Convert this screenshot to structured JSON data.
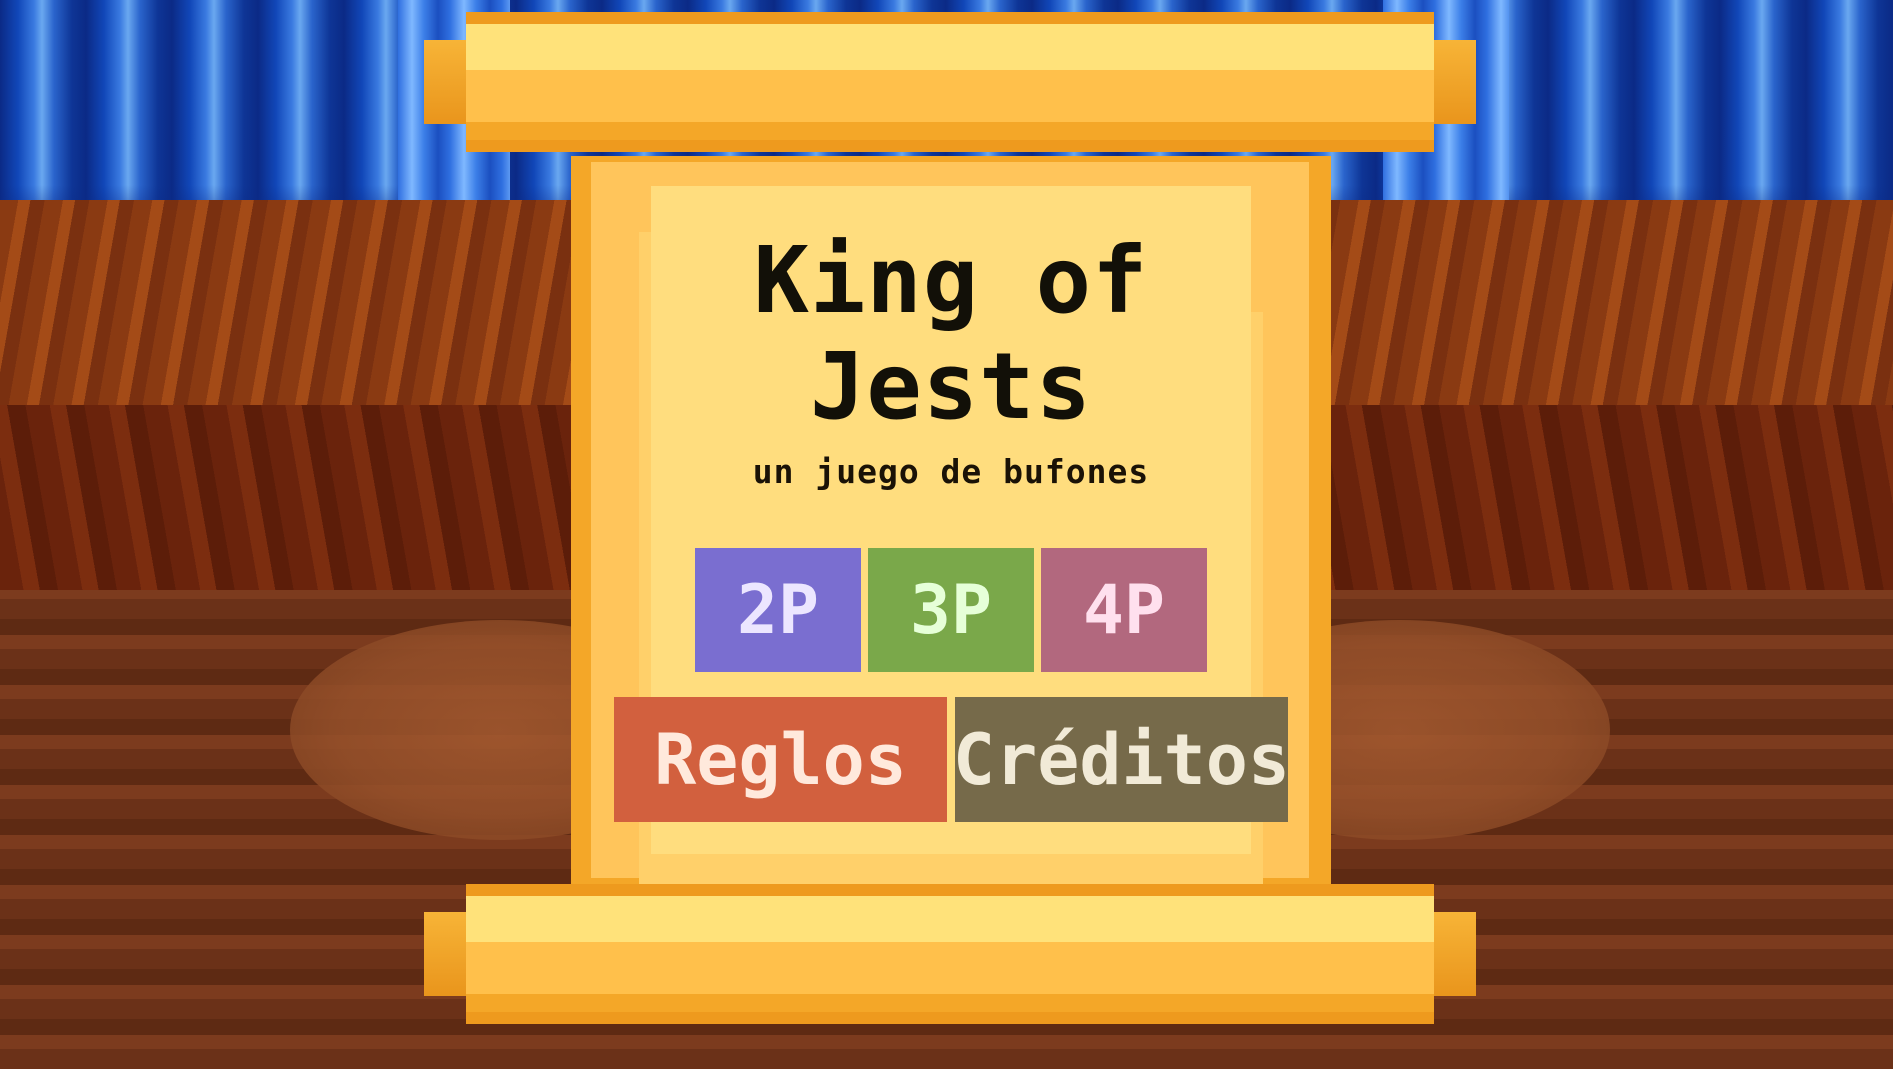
{
  "game": {
    "title_line1": "King of",
    "title_line2": "Jests",
    "subtitle": "un juego de bufones"
  },
  "menu": {
    "players": [
      {
        "label": "2P",
        "color": "#7a6ed0"
      },
      {
        "label": "3P",
        "color": "#7aa84a"
      },
      {
        "label": "4P",
        "color": "#b2687e"
      }
    ],
    "rules_label": "Reglos",
    "credits_label": "Créditos"
  },
  "colors": {
    "curtain": "#1147b8",
    "scroll": "#ffc55b",
    "stage": "#7c3b1e"
  }
}
